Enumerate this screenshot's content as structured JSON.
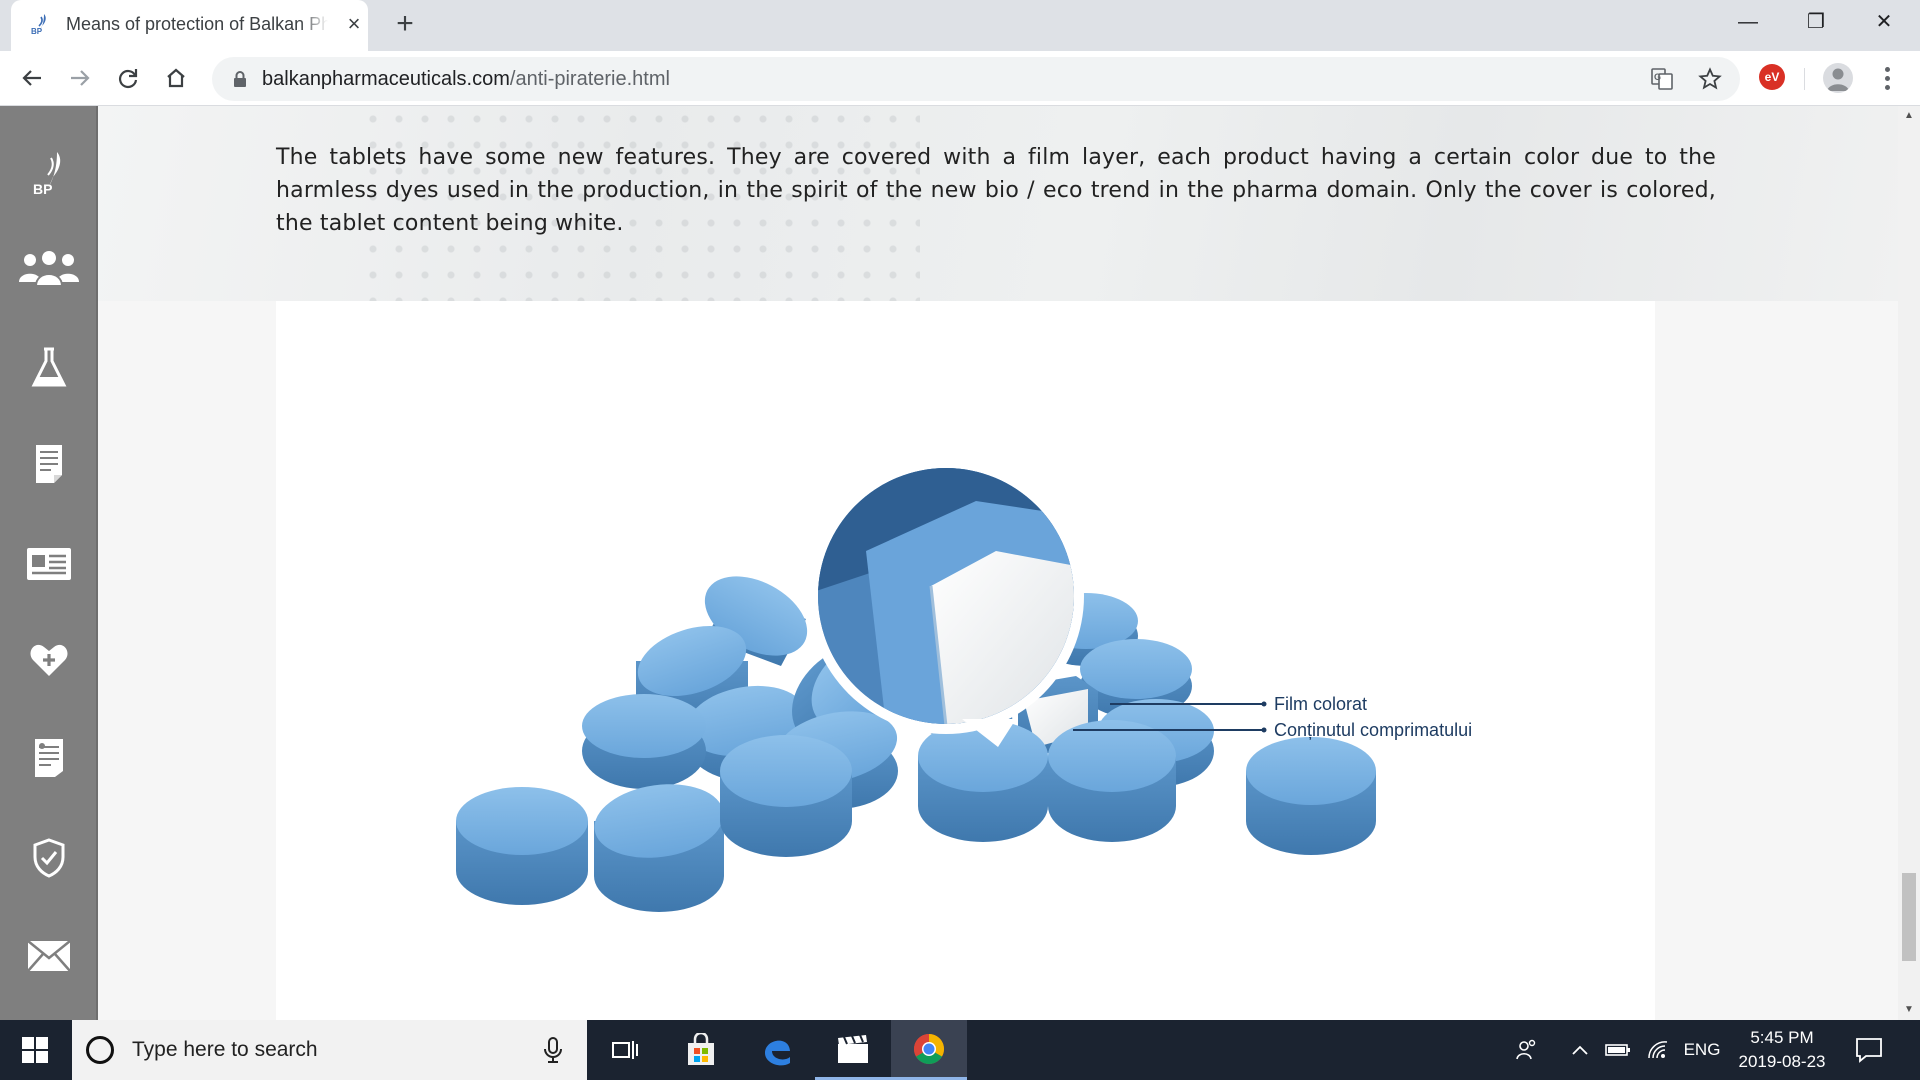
{
  "browser": {
    "tab_title": "Means of protection of Balkan Pharmaceuticals",
    "tab_close": "×",
    "new_tab": "+",
    "url_domain": "balkanpharmaceuticals.com",
    "url_path": "/anti-piraterie.html",
    "extension_badge": "eV"
  },
  "window_controls": {
    "minimize": "—",
    "maximize": "❐",
    "close": "✕"
  },
  "sidebar": {
    "logo_text": "BP",
    "items": [
      {
        "icon": "logo-icon"
      },
      {
        "icon": "people-icon"
      },
      {
        "icon": "flask-icon"
      },
      {
        "icon": "document-icon"
      },
      {
        "icon": "id-card-icon"
      },
      {
        "icon": "heart-plus-icon"
      },
      {
        "icon": "certificate-icon"
      },
      {
        "icon": "shield-check-icon"
      },
      {
        "icon": "envelope-icon"
      }
    ]
  },
  "content": {
    "intro": "The tablets have some new features. They are covered with a film layer, each product having a certain color due to the harmless dyes used in the production, in the spirit of the new bio / eco trend in the pharma domain. Only the cover is colored, the tablet content being white.",
    "figure_labels": {
      "film": "Film colorat",
      "core": "Conținutul comprimatului"
    }
  },
  "taskbar": {
    "search_placeholder": "Type here to search",
    "language": "ENG",
    "time": "5:45 PM",
    "date": "2019-08-23"
  },
  "colors": {
    "sidebar_bg": "#7f7f7f",
    "tablet_blue": "#6fa9dc",
    "label_navy": "#1e3c62",
    "taskbar_bg": "#1b2330"
  }
}
